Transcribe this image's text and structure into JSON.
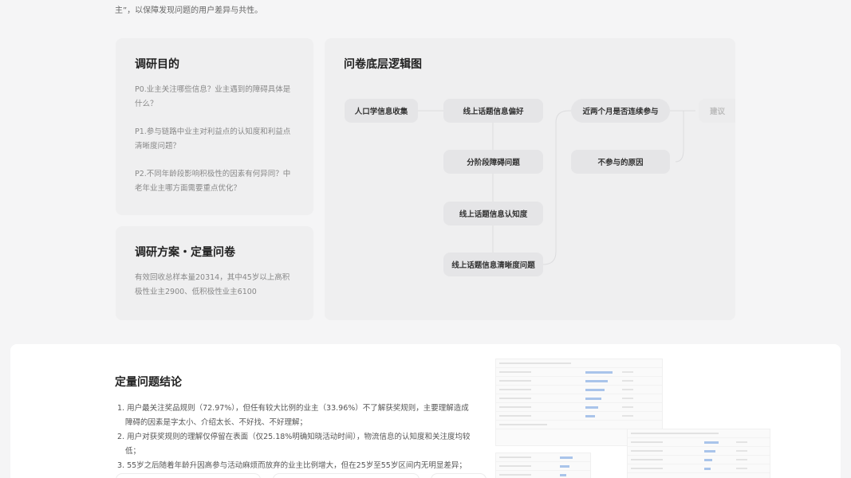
{
  "intro": {
    "text": "主”，以保障发现问题的用户差异与共性。"
  },
  "purpose": {
    "title": "调研目的",
    "items": [
      "P0.业主关注哪些信息？业主遇到的障碍具体是什么？",
      "P1.参与链路中业主对利益点的认知度和利益点清晰度问题？",
      "P2.不同年龄段影响积极性的因素有何异同？中老年业主哪方面需要重点优化？"
    ]
  },
  "plan": {
    "title": "调研方案・定量问卷",
    "text": "有效回收总样本量20314，其中45岁以上高积极性业主2900、低积极性业主6100"
  },
  "logic": {
    "title": "问卷底层逻辑图",
    "nodes": {
      "demographics": "人口学信息收集",
      "online_pref": "线上话题信息偏好",
      "stage_barrier": "分阶段障碍问题",
      "online_cognition": "线上话题信息认知度",
      "online_clarity": "线上话题信息清晰度问题",
      "continuous": "近两个月是否连续参与",
      "not_join": "不参与的原因",
      "suggest": "建议"
    }
  },
  "conclusion": {
    "title": "定量问题结论",
    "items": [
      "1. 用户最关注奖品规则（72.97%），但任有较大比例的业主（33.96%）不了解获奖规则，主要理解造成障碍的因素是字太小、介绍太长、不好找、不好理解；",
      "2. 用户对获奖规则的理解仅停留在表面（仅25.18%明确知晓活动时间），物流信息的认知度和关注度均较低；",
      "3. 55岁之后随着年龄升因高参与活动麻烦而放弃的业主比例增大，但在25岁至55岁区间内无明显差异；"
    ]
  },
  "colors": {
    "page_bg": "#f5f5f6",
    "card_bg": "#efeff0",
    "node_bg": "#e5e5e7",
    "bar_accent": "#a9c4ea"
  }
}
